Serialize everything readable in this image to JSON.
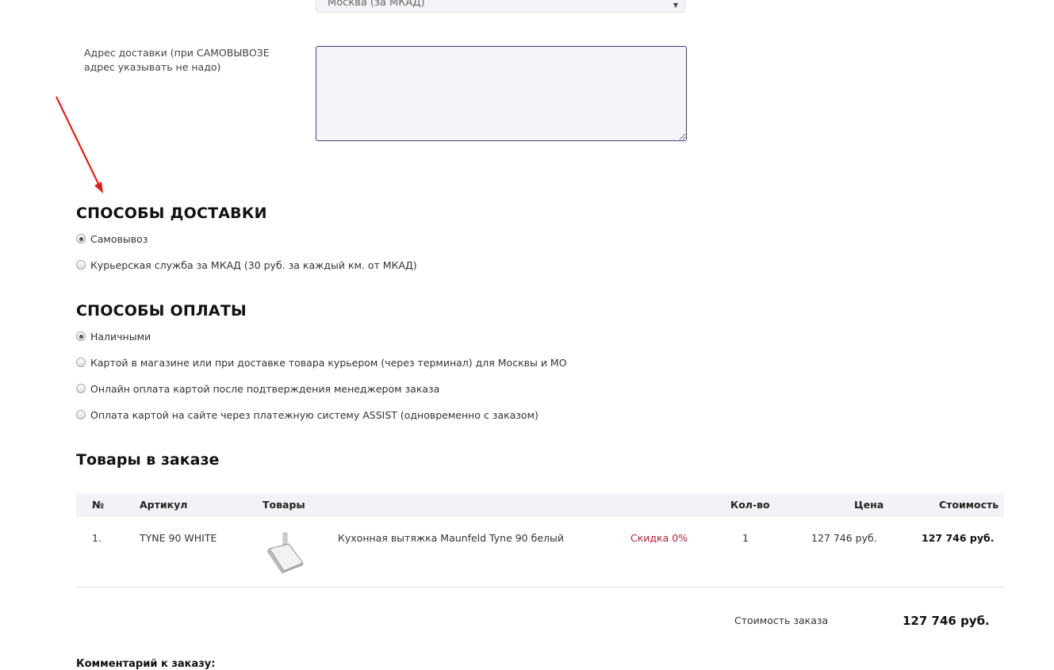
{
  "delivery_region": {
    "selected": "Москва (за МКАД)"
  },
  "address": {
    "label": "Адрес доставки (при САМОВЫВОЗЕ адрес указывать не надо)",
    "value": ""
  },
  "delivery_methods": {
    "title": "СПОСОБЫ ДОСТАВКИ",
    "options": [
      {
        "label": "Самовывоз",
        "checked": true
      },
      {
        "label": "Курьерская служба за МКАД (30 руб. за каждый км. от МКАД)",
        "checked": false
      }
    ]
  },
  "payment_methods": {
    "title": "СПОСОБЫ ОПЛАТЫ",
    "options": [
      {
        "label": "Наличными",
        "checked": true
      },
      {
        "label": "Картой в магазине или при доставке товара курьером (через терминал) для Москвы и МО",
        "checked": false
      },
      {
        "label": "Онлайн оплата картой после подтверждения менеджером заказа",
        "checked": false
      },
      {
        "label": "Оплата картой на сайте через платежную систему ASSIST (одновременно с заказом)",
        "checked": false
      }
    ]
  },
  "order_items": {
    "title": "Товары в заказе",
    "columns": {
      "num": "№",
      "sku": "Артикул",
      "goods": "Товары",
      "qty": "Кол-во",
      "price": "Цена",
      "cost": "Стоимость"
    },
    "rows": [
      {
        "num": "1.",
        "sku": "TYNE 90 WHITE",
        "name": "Кухонная вытяжка Maunfeld Tyne 90 белый",
        "discount": "Скидка 0%",
        "qty": "1",
        "price": "127 746 руб.",
        "cost": "127 746 руб."
      }
    ]
  },
  "order_total": {
    "label": "Стоимость заказа",
    "value": "127 746 руб."
  },
  "comment": {
    "label": "Комментарий к заказу:"
  },
  "colors": {
    "accent_red": "#e0201c",
    "discount_red": "#b0203a",
    "textarea_border": "#3b3f7a"
  },
  "icons": {
    "arrow": "red-arrow-annotation",
    "product": "range-hood-thumbnail"
  }
}
